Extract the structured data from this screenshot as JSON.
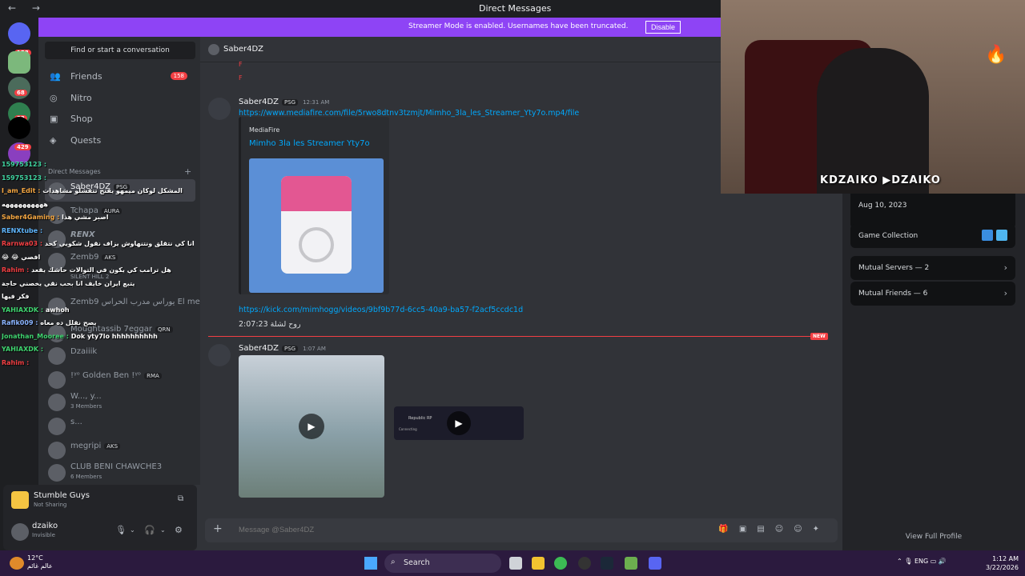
{
  "window": {
    "title": "Direct Messages",
    "nav_arrows": "← →"
  },
  "banner": {
    "text": "Streamer Mode is enabled. Usernames have been truncated.",
    "button": "Disable"
  },
  "guilds": [
    {
      "badge": "158"
    },
    {
      "badge": ""
    },
    {
      "badge": "68"
    },
    {
      "badge": "22"
    },
    {
      "badge": ""
    },
    {
      "badge": "429"
    }
  ],
  "sidebar": {
    "search_label": "Find or start a conversation",
    "nav": [
      {
        "label": "Friends",
        "count": "158",
        "icon": "friends-icon"
      },
      {
        "label": "Nitro",
        "icon": "nitro-icon"
      },
      {
        "label": "Shop",
        "icon": "shop-icon"
      },
      {
        "label": "Quests",
        "icon": "quests-icon"
      }
    ],
    "dm_header": "Direct Messages",
    "dms": [
      {
        "name": "Saber4DZ",
        "tag": "PSG"
      },
      {
        "name": "Tchapa",
        "tag": "AURA"
      },
      {
        "name": "RENX",
        "tag": ""
      },
      {
        "name": "Zemb9",
        "tag": "AKS"
      },
      {
        "name": "",
        "tag": "",
        "sub": "SILENT HILL 2"
      },
      {
        "name": "Zemb9 يوراس مدرب الحراس El me...",
        "tag": ""
      },
      {
        "name": "Moughtassib 7eggar",
        "tag": "QRN"
      },
      {
        "name": "Dzaiiik",
        "tag": ""
      },
      {
        "name": "!ᵞᵒ Golden Ben !ᵞᵒ",
        "tag": "RMA"
      },
      {
        "name": "W..., y...",
        "tag": "",
        "sub": "3 Members"
      },
      {
        "name": "s...",
        "tag": ""
      },
      {
        "name": "megripi",
        "tag": "AKS"
      },
      {
        "name": "CLUB BENI CHAWCHE3",
        "tag": "",
        "sub": "6 Members"
      }
    ]
  },
  "chat_overlay": [
    {
      "user": "1597531​23 :",
      "text": ""
    },
    {
      "user": "1597531​23 :",
      "text": ""
    },
    {
      "user": "I_am_Edit :",
      "text": "المشكل لوكان ميمهو يفتح تتفشلو مشاهدات"
    },
    {
      "user": "",
      "text": "ههههههههههه"
    },
    {
      "user": "Saber4Gaming :",
      "text": "اصبر مشي هذا"
    },
    {
      "user": "RENXtube :",
      "text": ""
    },
    {
      "user": "Rarnwa03 :",
      "text": "انا كي نتقلق ونتنهاوش يزاف نقول شكويي كحد"
    },
    {
      "user": "",
      "text": "😂 😂 افصي"
    },
    {
      "user": "Rahim :",
      "text": "هل ترامب كي يكون في التوالات حاشك يقعد"
    },
    {
      "user": "",
      "text": "يتبع ايران خايف انا بحب نقي يخصني حاجة"
    },
    {
      "user": "",
      "text": "فكر فيها"
    },
    {
      "user": "YAHIAXDK :",
      "text": "awhoh"
    },
    {
      "user": "Rafik009 :",
      "text": "يصح نقلل ده معاه"
    },
    {
      "user": "Jonathan_Mooree :",
      "text": "Dok yty7lo hhhhhhhhhh"
    },
    {
      "user": "YAHIAXDK :",
      "text": ""
    },
    {
      "user": "Rahim :",
      "text": ""
    }
  ],
  "user_panel": {
    "activity_title": "Stumble Guys",
    "activity_sub": "Not Sharing",
    "username": "dzaiko",
    "status": "Invisible"
  },
  "chat": {
    "header_name": "Saber4DZ",
    "stray_lines": [
      "F",
      "F"
    ],
    "msg1": {
      "author": "Saber4DZ",
      "tag": "PSG",
      "time": "12:31 AM",
      "link": "https://www.mediafire.com/file/5rwo8dtnv3tzmjt/Mimho_3la_les_Streamer_Yty7o.mp4/file",
      "embed_provider": "MediaFire",
      "embed_title": "Mimho 3la les Streamer Yty7o",
      "link2": "https://kick.com/mimhogg/videos/9bf9b77d-6cc5-40a9-ba57-f2acf5ccdc1d",
      "text": "روح لشلة 2:07:23"
    },
    "new_badge": "NEW",
    "msg2": {
      "author": "Saber4DZ",
      "tag": "PSG",
      "time": "1:07 AM",
      "video2_title": "Republic RP",
      "video2_status": "Connecting"
    },
    "composer_placeholder": "Message @Saber4DZ"
  },
  "profile": {
    "member_since_date": "Aug 10, 2023",
    "game_collection": "Game Collection",
    "mutual_servers": "Mutual Servers — 2",
    "mutual_friends": "Mutual Friends — 6",
    "view_full": "View Full Profile"
  },
  "webcam": {
    "overlay_text": "KDZAIKO ▶DZAIKO"
  },
  "taskbar": {
    "temp": "12°C",
    "weather_sub": "عالم غائم",
    "search": "Search",
    "lang": "ENG",
    "time": "1:12 AM",
    "date": "3/22/2026"
  }
}
